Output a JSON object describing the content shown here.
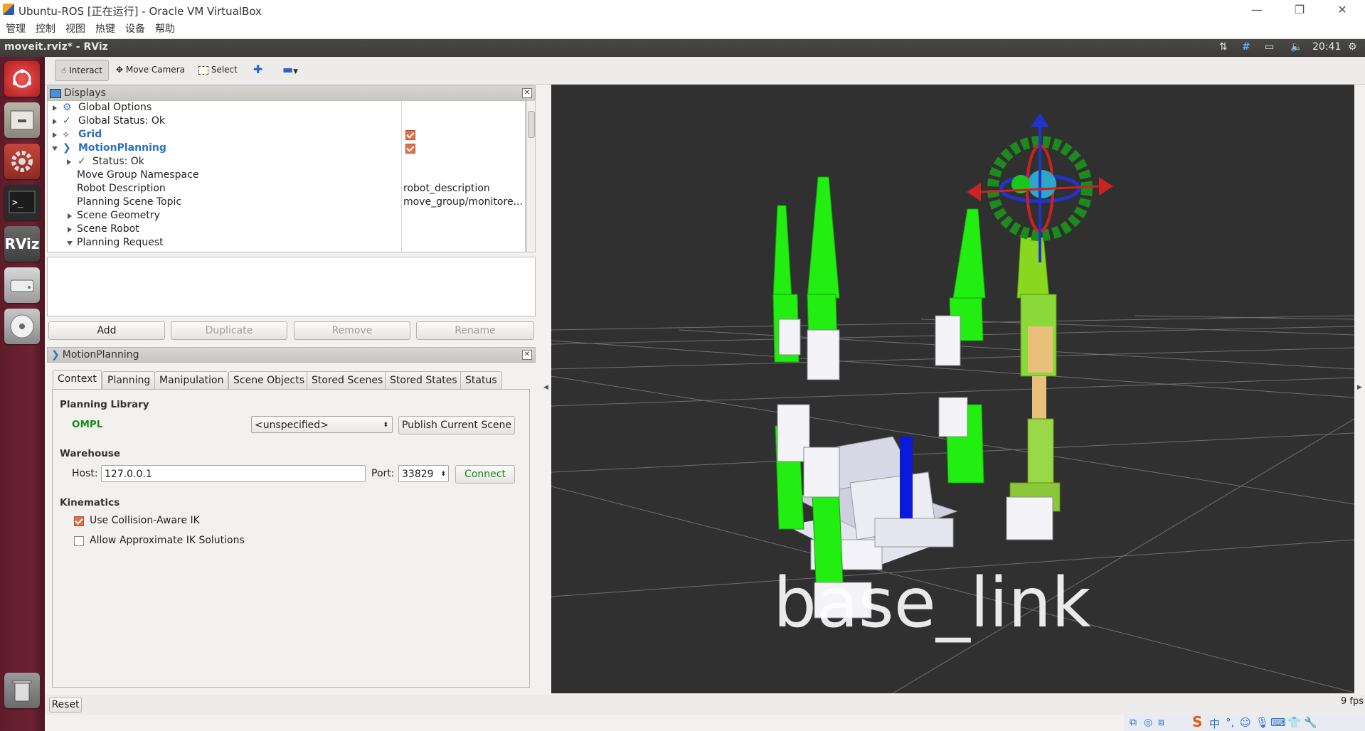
{
  "vbox": {
    "title": "Ubuntu-ROS [正在运行] - Oracle VM VirtualBox",
    "menu": [
      "管理",
      "控制",
      "视图",
      "热键",
      "设备",
      "帮助"
    ],
    "win_minimize": "—",
    "win_restore": "❐",
    "win_close": "✕"
  },
  "panel": {
    "window_title": "moveit.rviz* - RViz",
    "clock": "20:41"
  },
  "launcher": {
    "items": [
      "ubuntu-dash-icon",
      "files-icon",
      "system-settings-icon",
      "terminal-icon",
      "rviz-icon",
      "disk-icon",
      "dvd-icon",
      "trash-icon"
    ],
    "rviz_text": "RViz"
  },
  "toolbar": {
    "interact": "Interact",
    "move_camera": "Move Camera",
    "select": "Select"
  },
  "displays": {
    "title": "Displays",
    "rows": [
      {
        "label": "Global Options",
        "value": ""
      },
      {
        "label": "Global Status: Ok",
        "value": ""
      },
      {
        "label": "Grid",
        "value": ""
      },
      {
        "label": "MotionPlanning",
        "value": ""
      },
      {
        "label": "Status: Ok",
        "value": ""
      },
      {
        "label": "Move Group Namespace",
        "value": ""
      },
      {
        "label": "Robot Description",
        "value": "robot_description"
      },
      {
        "label": "Planning Scene Topic",
        "value": "move_group/monitore..."
      },
      {
        "label": "Scene Geometry",
        "value": ""
      },
      {
        "label": "Scene Robot",
        "value": ""
      },
      {
        "label": "Planning Request",
        "value": ""
      }
    ],
    "buttons": {
      "add": "Add",
      "duplicate": "Duplicate",
      "remove": "Remove",
      "rename": "Rename"
    }
  },
  "motion_planning": {
    "title": "MotionPlanning",
    "tabs": [
      "Context",
      "Planning",
      "Manipulation",
      "Scene Objects",
      "Stored Scenes",
      "Stored States",
      "Status"
    ],
    "planning_library_label": "Planning Library",
    "library_name": "OMPL",
    "planner_select": "<unspecified>",
    "publish_button": "Publish Current Scene",
    "warehouse_label": "Warehouse",
    "host_label": "Host:",
    "host_value": "127.0.0.1",
    "port_label": "Port:",
    "port_value": "33829",
    "connect_button": "Connect",
    "kinematics_label": "Kinematics",
    "collision_ik": "Use Collision-Aware IK",
    "approx_ik": "Allow Approximate IK Solutions"
  },
  "view": {
    "frame_label": "base_link",
    "fps": "9 fps"
  },
  "status": {
    "reset": "Reset"
  },
  "colors": {
    "background3d": "#303030",
    "robot_green": "#22ee11",
    "launcher": "#6d2233",
    "link_blue": "#2a6fc6",
    "ompl_green": "#1a8a1a"
  }
}
